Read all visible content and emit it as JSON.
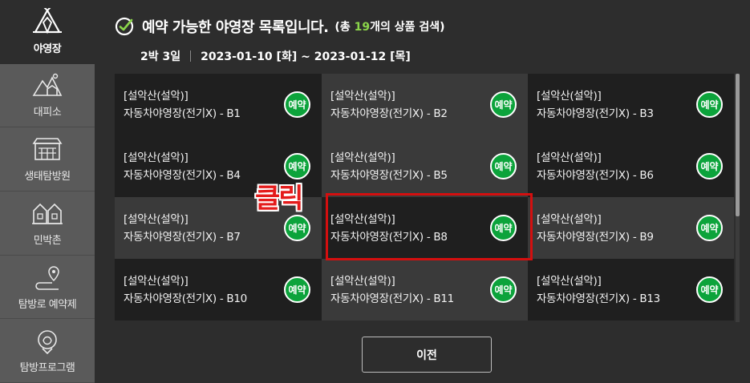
{
  "sidebar": {
    "items": [
      {
        "label": "야영장",
        "icon": "tent-icon",
        "active": true
      },
      {
        "label": "대피소",
        "icon": "mountain-shelter-icon"
      },
      {
        "label": "생태탐방원",
        "icon": "eco-center-icon"
      },
      {
        "label": "민박촌",
        "icon": "village-icon"
      },
      {
        "label": "탐방로 예약제",
        "icon": "trail-pin-icon"
      },
      {
        "label": "탐방프로그램",
        "icon": "program-guide-icon"
      }
    ]
  },
  "header": {
    "title": "예약 가능한 야영장 목록입니다.",
    "count_prefix": "(총 ",
    "count_value": "19",
    "count_suffix": "개의 상품 검색)",
    "nights": "2박 3일",
    "dates": "2023-01-10 [화] ~ 2023-01-12 [목]"
  },
  "reserve_label": "예약",
  "sites": [
    {
      "park": "[설악산(설악)]",
      "name": "자동차야영장(전기X) - B1"
    },
    {
      "park": "[설악산(설악)]",
      "name": "자동차야영장(전기X) - B2"
    },
    {
      "park": "[설악산(설악)]",
      "name": "자동차야영장(전기X) - B3"
    },
    {
      "park": "[설악산(설악)]",
      "name": "자동차야영장(전기X) - B4"
    },
    {
      "park": "[설악산(설악)]",
      "name": "자동차야영장(전기X) - B5"
    },
    {
      "park": "[설악산(설악)]",
      "name": "자동차야영장(전기X) - B6"
    },
    {
      "park": "[설악산(설악)]",
      "name": "자동차야영장(전기X) - B7"
    },
    {
      "park": "[설악산(설악)]",
      "name": "자동차야영장(전기X) - B8"
    },
    {
      "park": "[설악산(설악)]",
      "name": "자동차야영장(전기X) - B9"
    },
    {
      "park": "[설악산(설악)]",
      "name": "자동차야영장(전기X) - B10"
    },
    {
      "park": "[설악산(설악)]",
      "name": "자동차야영장(전기X) - B11"
    },
    {
      "park": "[설악산(설악)]",
      "name": "자동차야영장(전기X) - B13"
    }
  ],
  "annotation": {
    "click_label": "클릭"
  },
  "footer": {
    "prev_label": "이전"
  },
  "colors": {
    "reserve_green": "#0ca33b",
    "highlight_red": "#d40f0f",
    "count_green": "#8bd64a"
  }
}
